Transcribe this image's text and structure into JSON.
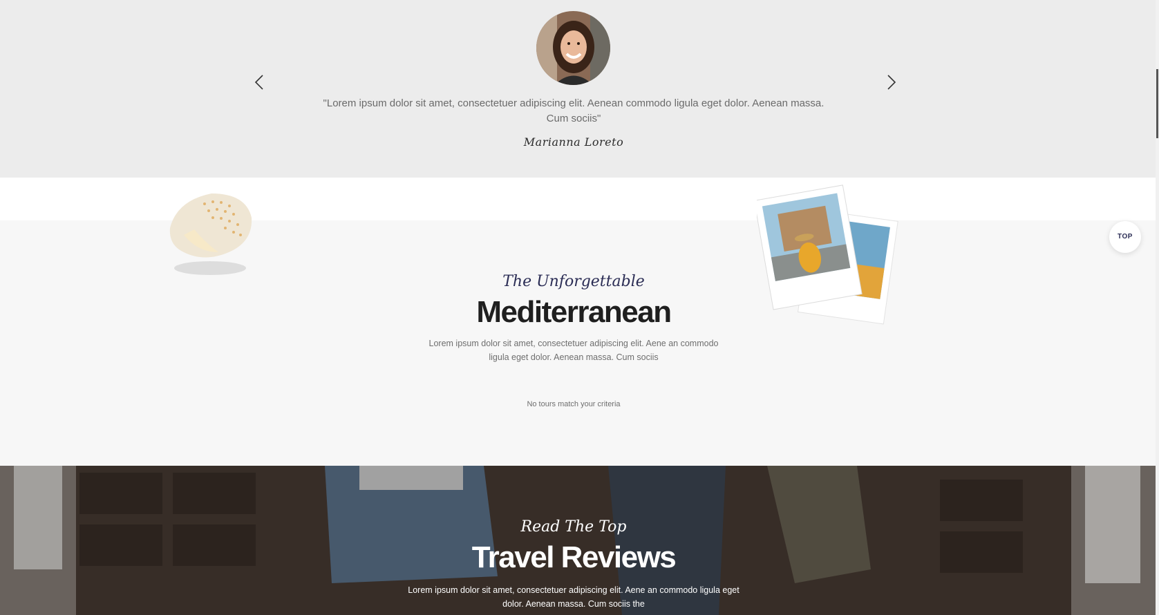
{
  "testimonial": {
    "quote": "\"Lorem ipsum dolor sit amet, consectetuer adipiscing elit. Aenean commodo ligula eget dolor. Aenean massa. Cum sociis\"",
    "author": "Marianna Loreto",
    "prev_icon": "chevron-left-icon",
    "next_icon": "chevron-right-icon",
    "background": "#ececec"
  },
  "mediterranean": {
    "script_title": "The Unforgettable",
    "title": "Mediterranean",
    "description": "Lorem ipsum dolor sit amet, consectetuer adipiscing elit. Aene an commodo ligula eget dolor. Aenean massa. Cum sociis",
    "empty_message": "No tours match your criteria",
    "accent": "#2b2d55"
  },
  "top_button": {
    "label": "TOP"
  },
  "reviews": {
    "script_title": "Read The Top",
    "title": "Travel Reviews",
    "description": "Lorem ipsum dolor sit amet, consectetuer adipiscing elit. Aene an commodo ligula eget dolor. Aenean massa. Cum sociis the"
  }
}
